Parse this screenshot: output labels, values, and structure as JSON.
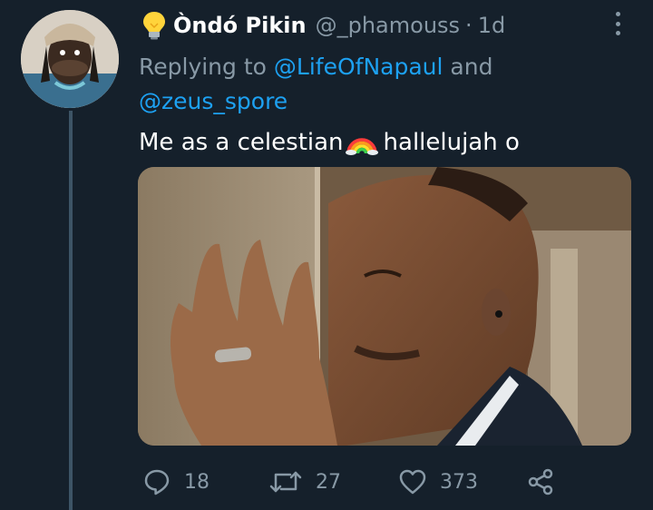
{
  "author": {
    "name": "Òndó Pikin",
    "handle": "@_phamouss",
    "separator": "·",
    "time": "1d",
    "name_emoji": "lightbulb-emoji"
  },
  "replying": {
    "prefix": "Replying to",
    "mention1": "@LifeOfNapaul",
    "conjunction": "and",
    "mention2": "@zeus_spore"
  },
  "tweet": {
    "text_before": "Me as a celestian",
    "emoji": "rainbow-emoji",
    "text_after": "hallelujah o"
  },
  "actions": {
    "reply_count": "18",
    "retweet_count": "27",
    "like_count": "373",
    "reply_icon": "reply-icon",
    "retweet_icon": "retweet-icon",
    "like_icon": "heart-icon",
    "share_icon": "share-icon"
  },
  "colors": {
    "background": "#15202b",
    "secondary_text": "#8899a6",
    "mention": "#1da1f2",
    "thread_line": "#3d5466"
  }
}
